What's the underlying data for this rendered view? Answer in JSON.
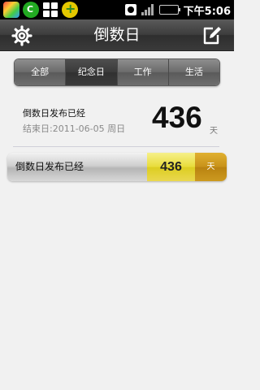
{
  "status_bar": {
    "time": "下午5:06"
  },
  "header": {
    "title": "倒数日",
    "settings_icon": "gear-icon",
    "edit_icon": "edit-icon"
  },
  "tabs": [
    {
      "label": "全部",
      "active": false
    },
    {
      "label": "纪念日",
      "active": true
    },
    {
      "label": "工作",
      "active": false
    },
    {
      "label": "生活",
      "active": false
    }
  ],
  "featured": {
    "title": "倒数日发布已经",
    "end_prefix": "结束日:",
    "end_date": "2011-06-05",
    "weekday": "周日",
    "days": "436",
    "unit": "天"
  },
  "list": [
    {
      "title": "倒数日发布已经",
      "days": "436",
      "unit": "天"
    }
  ],
  "colors": {
    "header_bg": "#3c3c3c",
    "days_yellow": "#e8dc3a",
    "unit_orange": "#c8921a",
    "background": "#f1f1f1"
  }
}
